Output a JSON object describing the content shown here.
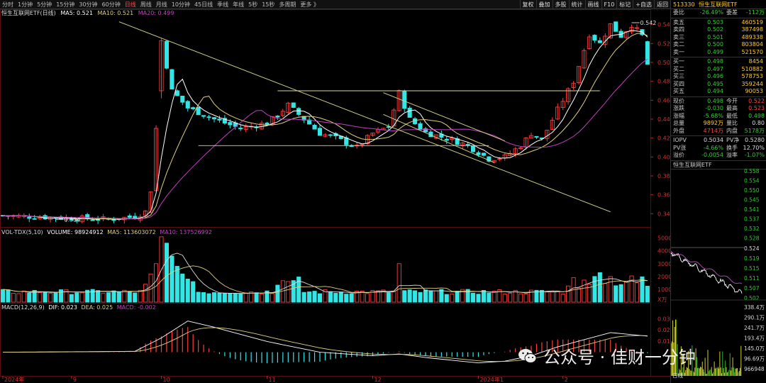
{
  "toolbar": {
    "timeframes": [
      "分时",
      "1分钟",
      "5分钟",
      "15分钟",
      "30分钟",
      "60分钟",
      "日线",
      "周线",
      "月线",
      "10分钟",
      "45日线",
      "季线",
      "年线",
      "5秒",
      "15秒",
      "多周期",
      "更多 》"
    ],
    "active": "日线",
    "buttons": [
      "复权",
      "叠加",
      "多股",
      "统计",
      "画线",
      "F10",
      "标记",
      "+自选",
      "返回"
    ]
  },
  "chart_title": "恒生互联网ETF(日线)",
  "ma": {
    "ma5": "MA5: 0.521",
    "ma10": "MA10: 0.521",
    "ma20": "MA20: 0.499"
  },
  "vol_label": {
    "name": "VOL-TDX(5,10)",
    "vol": "VOLUME: 98924912",
    "ma5": "MA5: 113603072",
    "ma10": "MA10: 137526992"
  },
  "macd_label": {
    "name": "MACD(12,26,9)",
    "dif": "DIF: 0.023",
    "dea": "DEA: 0.025",
    "macd": "MACD: -0.002"
  },
  "price_axis": [
    "0.540",
    "0.520",
    "0.500",
    "0.480",
    "0.460",
    "0.440",
    "0.420",
    "0.400",
    "0.380",
    "0.360",
    "0.340"
  ],
  "vol_axis": [
    "50000",
    "40000",
    "30000",
    "20000",
    "10000",
    "X万"
  ],
  "macd_axis": [
    "0.030",
    "0.020",
    "0.010"
  ],
  "date_axis": [
    "2024年",
    "9",
    "10",
    "11",
    "12",
    "2024年1",
    "2"
  ],
  "annotations": {
    "high": "0.542",
    "low": "0.334"
  },
  "colors": {
    "up": "#ff3c3c",
    "down": "#33e6e6",
    "ma5": "#ffffff",
    "ma10": "#e0d080",
    "ma20": "#c040c0",
    "trend": "#d8d88a"
  },
  "quote": {
    "header_code": "513330",
    "header_name": "恒生互联网ETF",
    "weibi": {
      "label": "委比",
      "value": "-26.49%",
      "label2": "委差",
      "value2": "-112万"
    },
    "asks": [
      {
        "label": "卖五",
        "price": "0.503",
        "vol": "460519"
      },
      {
        "label": "卖四",
        "price": "0.502",
        "vol": "387498"
      },
      {
        "label": "卖三",
        "price": "0.501",
        "vol": "489338"
      },
      {
        "label": "卖二",
        "price": "0.500",
        "vol": "803804"
      },
      {
        "label": "卖一",
        "price": "0.499",
        "vol": "521570"
      }
    ],
    "bids": [
      {
        "label": "买一",
        "price": "0.498",
        "vol": "8454"
      },
      {
        "label": "买二",
        "price": "0.497",
        "vol": "510882"
      },
      {
        "label": "买三",
        "price": "0.496",
        "vol": "578753"
      },
      {
        "label": "买四",
        "price": "0.495",
        "vol": "359244"
      },
      {
        "label": "买五",
        "price": "0.494",
        "vol": "90053"
      }
    ],
    "stats": [
      {
        "l1": "现价",
        "v1": "0.498",
        "l2": "今开",
        "v2": "0.522"
      },
      {
        "l1": "涨跌",
        "v1": "-0.030",
        "l2": "最高",
        "v2": "0.523"
      },
      {
        "l1": "涨幅",
        "v1": "-5.68%",
        "l2": "最低",
        "v2": "0.498"
      },
      {
        "l1": "总量",
        "v1": "9892万",
        "l2": "量比",
        "v2": "0.80"
      },
      {
        "l1": "外盘",
        "v1": "4714万",
        "l2": "内盘",
        "v2": "5178万"
      }
    ],
    "extra": [
      {
        "l1": "IOPV",
        "v1": "0.5034",
        "l2": "PV净",
        "v2": "0.5280"
      },
      {
        "l1": "PV涨",
        "v1": "-4.66%",
        "l2": "换手",
        "v2": "12.70%"
      },
      {
        "l1": "溢价",
        "v1": "-0.0054",
        "l2": "溢率",
        "v2": "-1.07%"
      }
    ],
    "mini_title": "恒生互联网ETF",
    "mini_axis_top": [
      "0.558",
      "0.554",
      "0.550",
      "0.545",
      "0.541",
      "0.537",
      "0.532",
      "0.528"
    ],
    "mini_axis_bottom": [
      "0.524",
      "0.519",
      "0.515",
      "0.511",
      "0.507",
      "0.502"
    ],
    "mini_vol_axis": [
      "338.4万",
      "290.1万",
      "241.7万",
      "193.4万",
      "145.0万",
      "96.69万",
      "966948"
    ],
    "mini_footer": "日线"
  },
  "watermark": {
    "text": "公众号 · 佳财一分钟"
  }
}
